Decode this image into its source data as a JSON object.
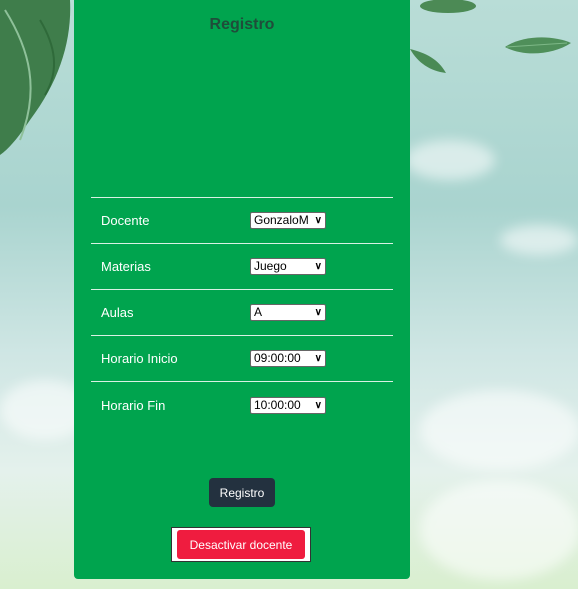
{
  "form": {
    "title": "Registro",
    "fields": [
      {
        "label": "Docente",
        "value": "GonzaloM"
      },
      {
        "label": "Materias",
        "value": "Juego"
      },
      {
        "label": "Aulas",
        "value": "A"
      },
      {
        "label": "Horario Inicio",
        "value": "09:00:00"
      },
      {
        "label": "Horario Fin",
        "value": "10:00:00"
      }
    ],
    "submit_label": "Registro",
    "deactivate_label": "Desactivar docente"
  },
  "colors": {
    "card_bg": "#00a44e",
    "submit_bg": "#23313f",
    "deactivate_bg": "#ef1c3f",
    "title_text": "#1f4d3a"
  },
  "icons": {
    "select_arrow": "chevron-down-icon"
  }
}
